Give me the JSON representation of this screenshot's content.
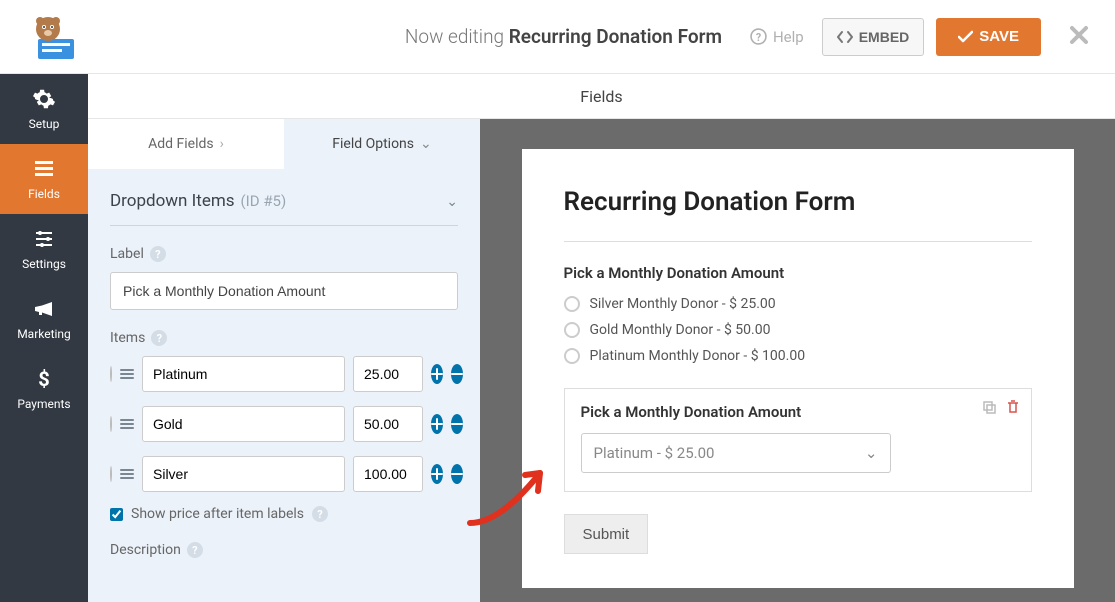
{
  "header": {
    "editing_prefix": "Now editing",
    "form_name": "Recurring Donation Form",
    "help_label": "Help",
    "embed_label": "EMBED",
    "save_label": "SAVE"
  },
  "sidebar": {
    "items": [
      {
        "label": "Setup"
      },
      {
        "label": "Fields"
      },
      {
        "label": "Settings"
      },
      {
        "label": "Marketing"
      },
      {
        "label": "Payments"
      }
    ]
  },
  "main": {
    "section_title": "Fields",
    "tabs": {
      "add": "Add Fields",
      "options": "Field Options"
    }
  },
  "panel": {
    "section_title": "Dropdown Items",
    "section_meta": "(ID #5)",
    "label_label": "Label",
    "label_value": "Pick a Monthly Donation Amount",
    "items_label": "Items",
    "items": [
      {
        "name": "Platinum",
        "price": "25.00"
      },
      {
        "name": "Gold",
        "price": "50.00"
      },
      {
        "name": "Silver",
        "price": "100.00"
      }
    ],
    "show_price_label": "Show price after item labels",
    "description_label": "Description"
  },
  "preview": {
    "form_title": "Recurring Donation Form",
    "q_label": "Pick a Monthly Donation Amount",
    "options": [
      "Silver Monthly Donor - $ 25.00",
      "Gold Monthly Donor - $ 50.00",
      "Platinum Monthly Donor - $ 100.00"
    ],
    "selected_label": "Pick a Monthly Donation Amount",
    "dropdown_value": "Platinum - $ 25.00",
    "submit_label": "Submit"
  }
}
